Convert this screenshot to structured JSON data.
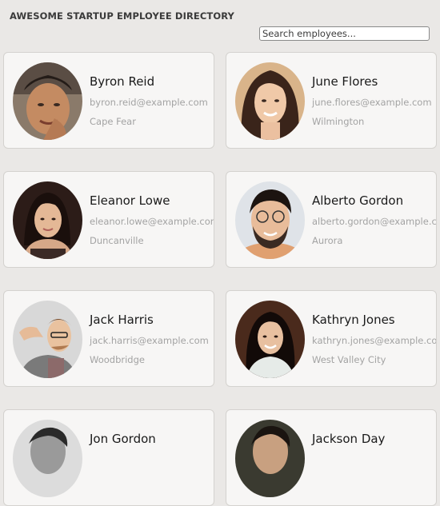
{
  "header": {
    "title": "AWESOME STARTUP EMPLOYEE DIRECTORY",
    "search_placeholder": "Search employees..."
  },
  "employees": [
    {
      "name": "Byron Reid",
      "email": "byron.reid@example.com",
      "city": "Cape Fear"
    },
    {
      "name": "June Flores",
      "email": "june.flores@example.com",
      "city": "Wilmington"
    },
    {
      "name": "Eleanor Lowe",
      "email": "eleanor.lowe@example.com",
      "city": "Duncanville"
    },
    {
      "name": "Alberto Gordon",
      "email": "alberto.gordon@example.com",
      "city": "Aurora"
    },
    {
      "name": "Jack Harris",
      "email": "jack.harris@example.com",
      "city": "Woodbridge"
    },
    {
      "name": "Kathryn Jones",
      "email": "kathryn.jones@example.com",
      "city": "West Valley City"
    },
    {
      "name": "Jon Gordon",
      "email": "",
      "city": ""
    },
    {
      "name": "Jackson Day",
      "email": "",
      "city": ""
    }
  ]
}
